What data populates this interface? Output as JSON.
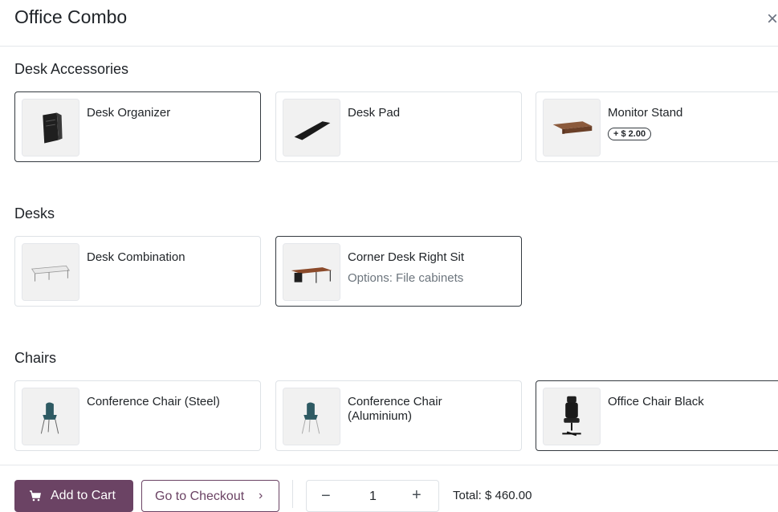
{
  "dialog": {
    "title": "Office Combo",
    "close_glyph": "×"
  },
  "sections": [
    {
      "title": "Desk Accessories",
      "items": [
        {
          "name": "Desk Organizer",
          "selected": true,
          "icon": "desk-organizer-image"
        },
        {
          "name": "Desk Pad",
          "selected": false,
          "icon": "desk-pad-image"
        },
        {
          "name": "Monitor Stand",
          "selected": false,
          "badge": "+ $ 2.00",
          "icon": "monitor-stand-image"
        }
      ]
    },
    {
      "title": "Desks",
      "items": [
        {
          "name": "Desk Combination",
          "selected": false,
          "icon": "desk-combination-image"
        },
        {
          "name": "Corner Desk Right Sit",
          "selected": true,
          "options": "Options: File cabinets",
          "icon": "corner-desk-image"
        }
      ]
    },
    {
      "title": "Chairs",
      "items": [
        {
          "name": "Conference Chair (Steel)",
          "selected": false,
          "icon": "conference-chair-image"
        },
        {
          "name": "Conference Chair (Aluminium)",
          "selected": false,
          "icon": "conference-chair-image"
        },
        {
          "name": "Office Chair Black",
          "selected": true,
          "icon": "office-chair-image"
        }
      ]
    }
  ],
  "footer": {
    "add_to_cart": "Add to Cart",
    "go_to_checkout": "Go to Checkout",
    "checkout_chevron": "›",
    "quantity": "1",
    "minus": "−",
    "plus": "+",
    "total": "Total: $ 460.00"
  },
  "colors": {
    "primary": "#6b4364",
    "selected_border": "#343a40",
    "border": "#dee2e6"
  }
}
